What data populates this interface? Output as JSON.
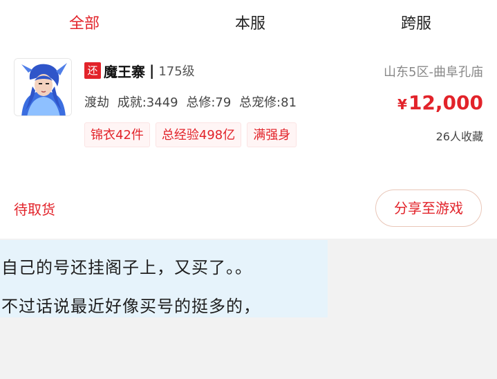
{
  "tabs": [
    {
      "label": "全部",
      "active": true
    },
    {
      "label": "本服",
      "active": false
    },
    {
      "label": "跨服",
      "active": false
    }
  ],
  "listing": {
    "badge": "还",
    "name": "魔王寨",
    "separator": "|",
    "level": "175级",
    "server": "山东5区-曲阜孔庙",
    "stats": [
      "渡劫",
      "成就:3449",
      "总修:79",
      "总宠修:81"
    ],
    "price_symbol": "¥",
    "price": "12,000",
    "favorites": "26人收藏",
    "tags": [
      "锦衣42件",
      "总经验498亿",
      "满强身"
    ],
    "status": "待取货",
    "share_label": "分享至游戏"
  },
  "comment": {
    "line1": "自己的号还挂阁子上，又买了。。",
    "line2": "不过话说最近好像买号的挺多的，"
  },
  "colors": {
    "accent": "#e2232a",
    "comment_bg": "#e6f3fb",
    "page_bg": "#f2f2f2"
  }
}
